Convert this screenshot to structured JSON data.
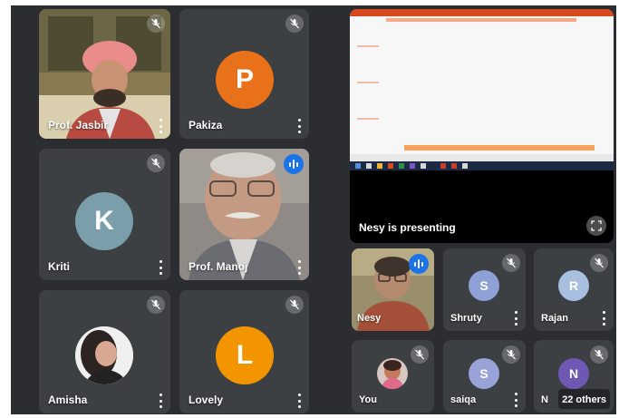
{
  "participants": {
    "jasbir": {
      "name": "Prof. Jasbir"
    },
    "pakiza": {
      "name": "Pakiza",
      "initial": "P",
      "color": "#e8711a"
    },
    "kriti": {
      "name": "Kriti",
      "initial": "K",
      "color": "#7a9fab"
    },
    "manoj": {
      "name": "Prof. Manoj"
    },
    "amisha": {
      "name": "Amisha"
    },
    "lovely": {
      "name": "Lovely",
      "initial": "L",
      "color": "#f29500"
    },
    "nesy": {
      "name": "Nesy"
    },
    "shruty": {
      "name": "Shruty",
      "initial": "S",
      "color": "#8fa0d6"
    },
    "rajan": {
      "name": "Rajan",
      "initial": "R",
      "color": "#a9bfe0"
    },
    "you": {
      "name": "You"
    },
    "saiqa": {
      "name": "saiqa",
      "initial": "S",
      "color": "#9aa3d8"
    },
    "n_tile": {
      "name": "N",
      "initial": "N",
      "color": "#6f57b4"
    }
  },
  "presentation": {
    "label": "Nesy is presenting"
  },
  "others": {
    "label": "22 others"
  },
  "icons": {
    "mic_muted": "mic-off-icon",
    "speaking": "audio-level-icon",
    "more": "more-vert-icon",
    "fullscreen": "fullscreen-icon"
  }
}
